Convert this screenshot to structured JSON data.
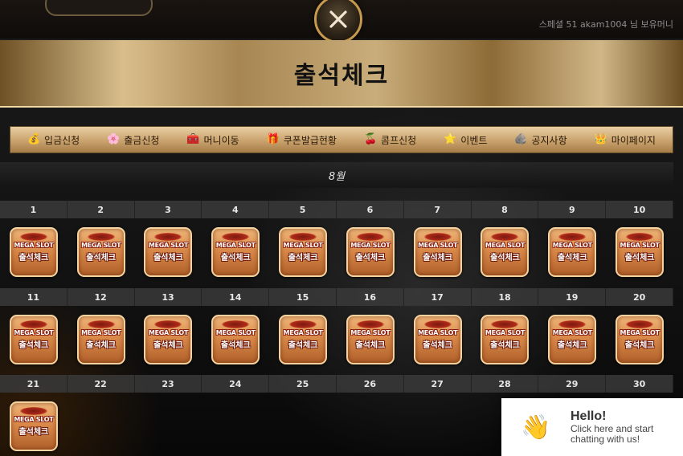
{
  "header": {
    "user_info": "스페셜 51   akam1004 님   보유머니"
  },
  "modal": {
    "title": "출석체크",
    "month": "8월"
  },
  "nav": {
    "items": [
      {
        "label": "입금신청",
        "icon": "deposit-bag-icon",
        "glyph": "💰"
      },
      {
        "label": "출금신청",
        "icon": "withdraw-icon",
        "glyph": "🌸"
      },
      {
        "label": "머니이동",
        "icon": "money-transfer-icon",
        "glyph": "🧰"
      },
      {
        "label": "쿠폰발급현황",
        "icon": "coupon-icon",
        "glyph": "🎁"
      },
      {
        "label": "콤프신청",
        "icon": "comp-cherry-icon",
        "glyph": "🍒"
      },
      {
        "label": "이벤트",
        "icon": "event-star-icon",
        "glyph": "⭐"
      },
      {
        "label": "공지사항",
        "icon": "notice-icon",
        "glyph": "🪨"
      },
      {
        "label": "마이페이지",
        "icon": "mypage-icon",
        "glyph": "👑"
      }
    ]
  },
  "calendar": {
    "rows": [
      {
        "days": [
          "1",
          "2",
          "3",
          "4",
          "5",
          "6",
          "7",
          "8",
          "9",
          "10"
        ],
        "stamps": 10
      },
      {
        "days": [
          "11",
          "12",
          "13",
          "14",
          "15",
          "16",
          "17",
          "18",
          "19",
          "20"
        ],
        "stamps": 10
      },
      {
        "days": [
          "21",
          "22",
          "23",
          "24",
          "25",
          "26",
          "27",
          "28",
          "29",
          "30"
        ],
        "stamps": 1
      }
    ],
    "stamp_brand": "MEGA SLOT",
    "stamp_label": "출석체크"
  },
  "chat": {
    "hello": "Hello!",
    "sub": "Click here and start chatting with us!",
    "icon": "waving-hand-icon",
    "glyph": "👋"
  },
  "colors": {
    "gold": "#c59a4d",
    "stamp_orange": "#d98a4a"
  }
}
